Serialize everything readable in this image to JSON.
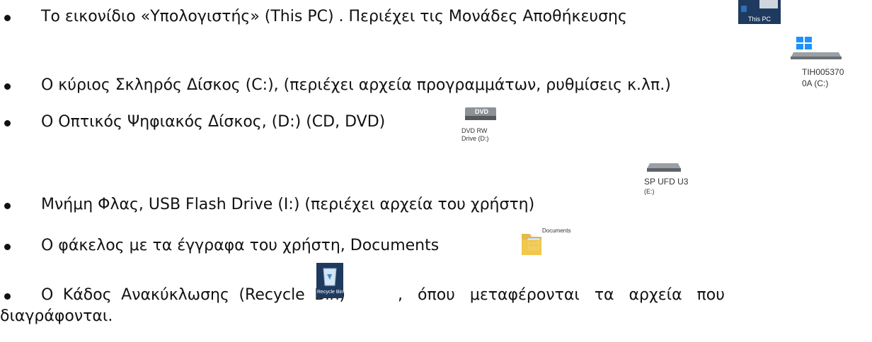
{
  "items": [
    {
      "text": "Το εικονίδιο «Υπολογιστής» (This PC) . Περιέχει τις Μονάδες Αποθήκευσης",
      "icon_label": "This PC",
      "icon": "this-pc-icon"
    },
    {
      "text": "Ο κύριος Σκληρός Δίσκος (C:), (περιέχει αρχεία προγραμμάτων, ρυθμίσεις κ.λπ.)",
      "icon_label_1": "TIH005370",
      "icon_label_2": "0A (C:)",
      "icon": "windows-drive-icon"
    },
    {
      "text": "Ο Οπτικός Ψηφιακός Δίσκος, (D:) (CD, DVD)",
      "icon_label_1": "DVD RW",
      "icon_label_2": "Drive (D:)",
      "icon_badge": "DVD",
      "icon": "dvd-drive-icon"
    },
    {
      "text": "Μνήμη Φλας, USB Flash Drive (I:) (περιέχει αρχεία του χρήστη)",
      "icon_label_1": "SP UFD U3",
      "icon_label_2": "(E:)",
      "icon": "usb-drive-icon"
    },
    {
      "text": "Ο  φάκελος με τα έγγραφα του χρήστη, Documents",
      "icon_label": "Documents",
      "icon": "documents-folder-icon"
    },
    {
      "text_words": [
        "Ο",
        "Κάδος",
        "Ανακύκλωσης",
        "(Recycle",
        "Bin)"
      ],
      "text_after": ", όπου μεταφέρονται τα αρχεία που",
      "text_line2": "διαγράφονται.",
      "icon_label": "Recycle Bin",
      "icon": "recycle-bin-icon"
    }
  ]
}
